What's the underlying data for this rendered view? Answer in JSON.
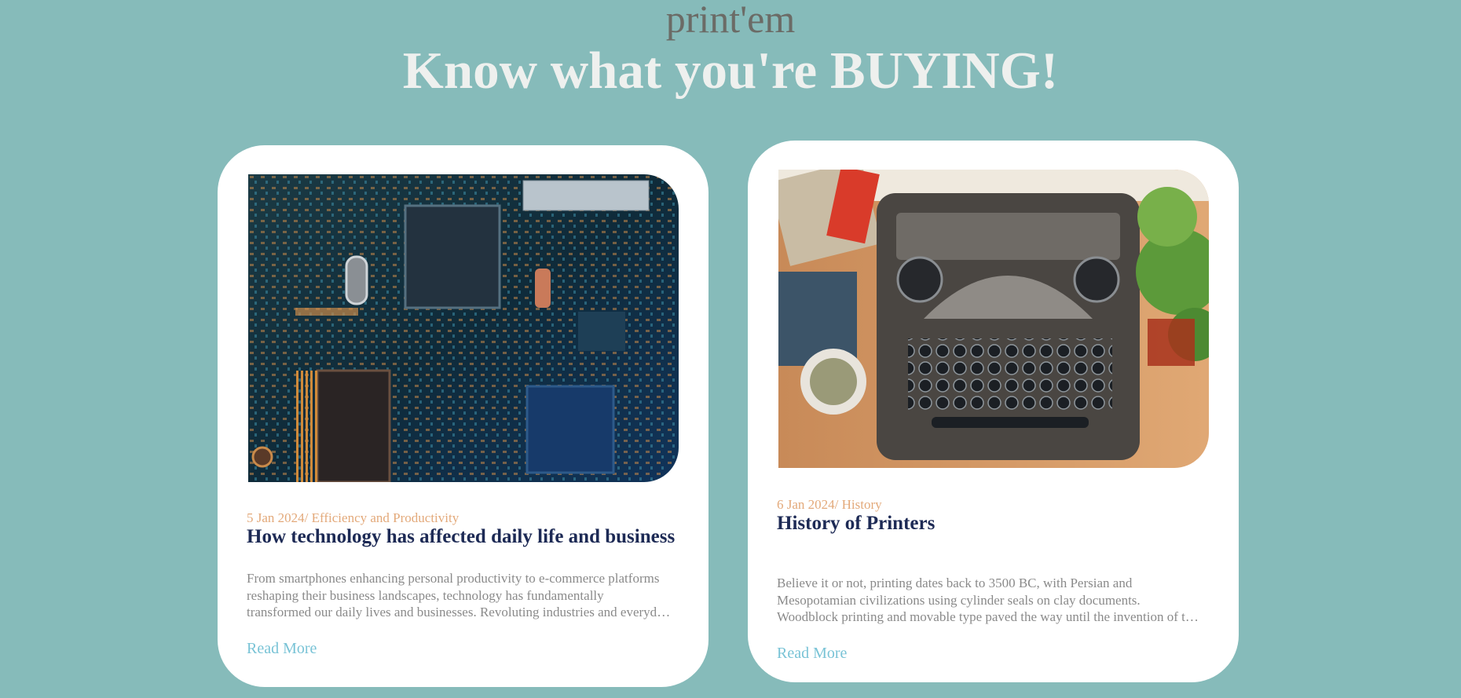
{
  "site": {
    "name": "print'em",
    "headline": "Know what you're BUYING!"
  },
  "articles": [
    {
      "meta": "5 Jan 2024/ Efficiency and Productivity",
      "title": "How technology has affected daily life and business",
      "excerpt": "From smartphones enhancing personal productivity to e-commerce platforms reshaping their business landscapes, technology has fundamentally transformed our daily lives and businesses. Revoluting industries and everyday routines alike.",
      "link": "Read More",
      "image": "circuit-board-photo"
    },
    {
      "meta": "6 Jan 2024/ History",
      "title": "History of Printers",
      "excerpt": "Believe it or not, printing dates back to 3500 BC, with Persian and Mesopotamian civilizations using cylinder seals on clay documents. Woodblock printing and movable type paved the way until the invention of the printing press.",
      "link": "Read More",
      "image": "typewriter-photo"
    }
  ],
  "colors": {
    "background": "#86bbba",
    "card": "#ffffff",
    "meta": "#e3a97a",
    "title": "#1d2a55",
    "excerpt": "#8a8a8a",
    "link": "#79c3d6"
  }
}
